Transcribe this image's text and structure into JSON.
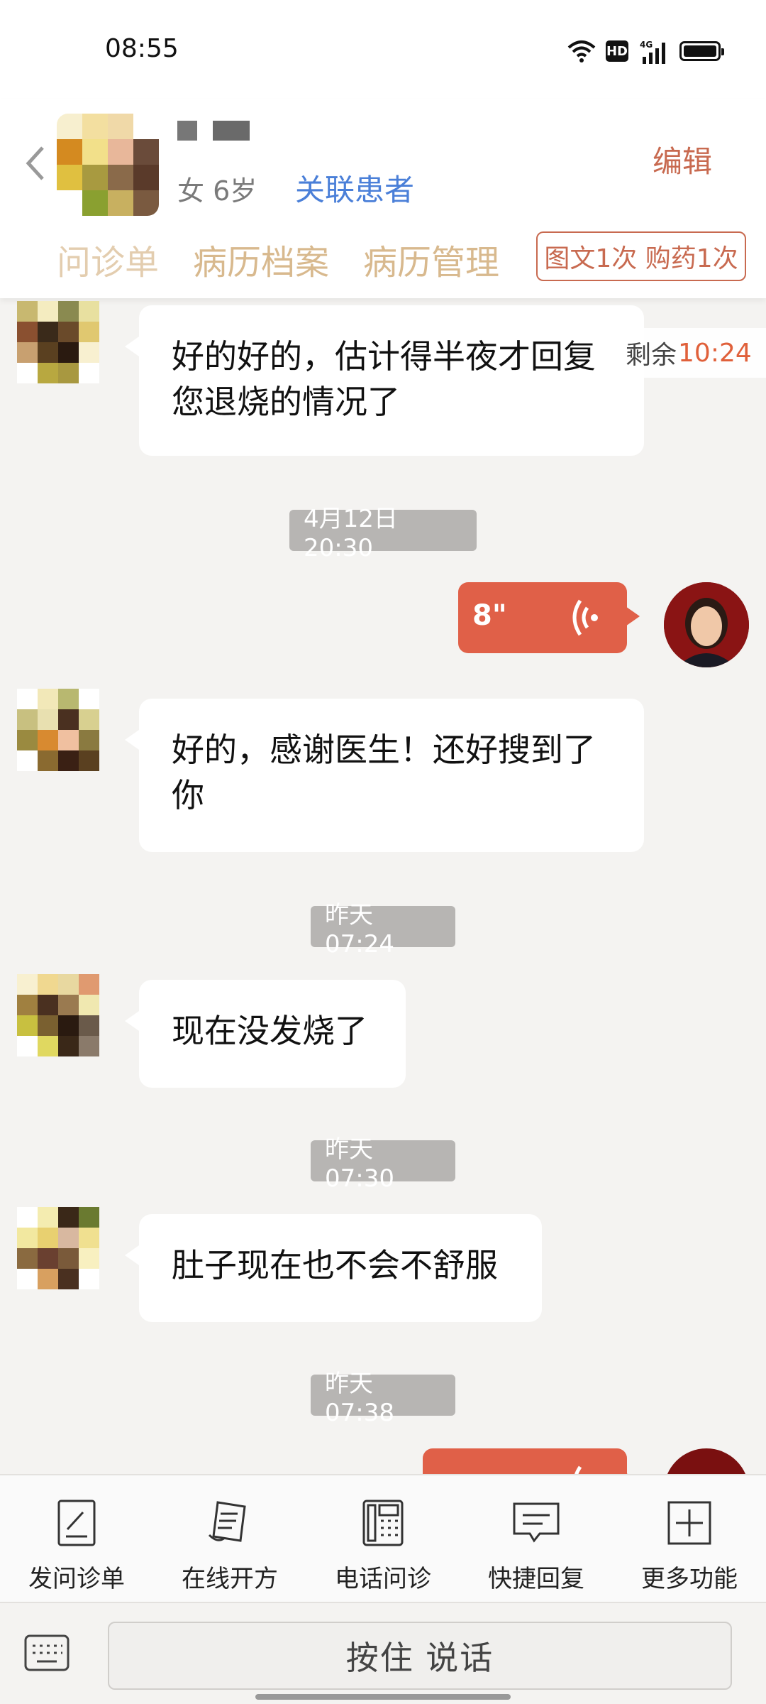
{
  "status_bar": {
    "time": "08:55",
    "hd": "HD",
    "network": "4G"
  },
  "header": {
    "patient_meta": "女 6岁",
    "link_patient": "关联患者",
    "edit": "编辑",
    "tabs": [
      "问诊单",
      "病历档案",
      "病历管理"
    ],
    "quota": "图文1次 购药1次"
  },
  "remaining": {
    "label": "剩余",
    "time": "10:24"
  },
  "messages": [
    {
      "type": "text",
      "text": "好的好的，估计得半夜才回复您退烧的情况了"
    },
    {
      "type": "timestamp",
      "text": "4月12日 20:30"
    },
    {
      "type": "voice",
      "duration": "8\""
    },
    {
      "type": "text",
      "text": "好的，感谢医生！还好搜到了你"
    },
    {
      "type": "timestamp",
      "text": "昨天 07:24"
    },
    {
      "type": "text",
      "text": "现在没发烧了"
    },
    {
      "type": "timestamp",
      "text": "昨天 07:30"
    },
    {
      "type": "text",
      "text": "肚子现在也不会不舒服"
    },
    {
      "type": "timestamp",
      "text": "昨天 07:38"
    }
  ],
  "toolbar": [
    {
      "label": "发问诊单",
      "icon": "form-icon"
    },
    {
      "label": "在线开方",
      "icon": "prescription-icon"
    },
    {
      "label": "电话问诊",
      "icon": "phone-icon"
    },
    {
      "label": "快捷回复",
      "icon": "quick-reply-icon"
    },
    {
      "label": "更多功能",
      "icon": "plus-icon"
    }
  ],
  "input": {
    "hold_to_talk": "按住 说话"
  },
  "colors": {
    "accent": "#c86a50",
    "voice_bubble": "#e06048",
    "link": "#4a7fd8",
    "tab_text": "#d8b98e",
    "chat_bg": "#f4f3f1"
  }
}
